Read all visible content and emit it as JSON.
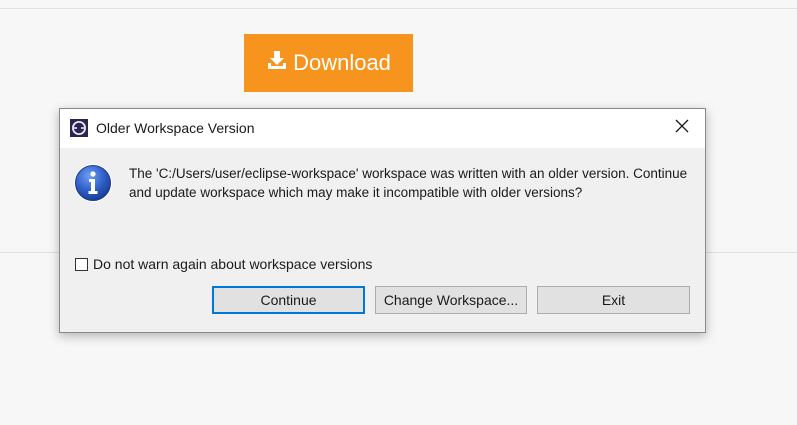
{
  "background": {
    "download_label": "Download",
    "download_color": "#f7941d"
  },
  "dialog": {
    "title": "Older Workspace Version",
    "message": "The 'C:/Users/user/eclipse-workspace' workspace was written with an older version. Continue and update workspace which may make it incompatible with older versions?",
    "checkbox_label": "Do not warn again about workspace versions",
    "checkbox_checked": false,
    "buttons": {
      "continue": "Continue",
      "change_workspace": "Change Workspace...",
      "exit": "Exit"
    },
    "accent_color": "#0078d7"
  },
  "icons": {
    "title": "eclipse-icon",
    "close": "close-icon",
    "info": "info-icon",
    "download": "download-icon"
  }
}
